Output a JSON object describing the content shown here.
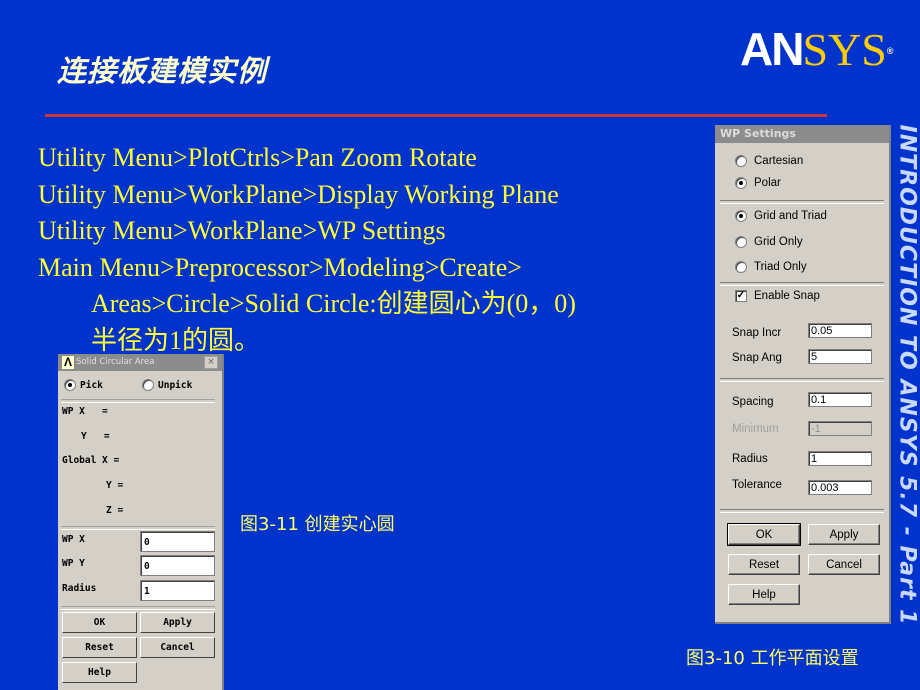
{
  "slide": {
    "title": "连接板建模实例",
    "logo": {
      "part1": "AN",
      "part2": "SYS",
      "reg": "®"
    },
    "side_text": "INTRODUCTION TO ANSYS 5.7 - Part 1",
    "lines": [
      "Utility Menu>PlotCtrls>Pan Zoom Rotate",
      "Utility Menu>WorkPlane>Display Working Plane",
      "Utility Menu>WorkPlane>WP Settings",
      "Main Menu>Preprocessor>Modeling>Create>",
      "Areas>Circle>Solid Circle:创建圆心为(0，0)",
      "半径为1的圆。"
    ],
    "caption_a": "图3-11  创建实心圆",
    "caption_b": "图3-10  工作平面设置"
  },
  "wp_settings": {
    "title": "WP Settings",
    "coord": [
      {
        "label": "Cartesian",
        "selected": false
      },
      {
        "label": "Polar",
        "selected": true
      }
    ],
    "display": [
      {
        "label": "Grid and Triad",
        "selected": true
      },
      {
        "label": "Grid Only",
        "selected": false
      },
      {
        "label": "Triad Only",
        "selected": false
      }
    ],
    "enable_snap": {
      "label": "Enable Snap",
      "checked": true
    },
    "fields": {
      "snap_incr": {
        "label": "Snap Incr",
        "value": "0.05"
      },
      "snap_ang": {
        "label": "Snap Ang",
        "value": "5"
      },
      "spacing": {
        "label": "Spacing",
        "value": "0.1"
      },
      "minimum": {
        "label": "Minimum",
        "value": "-1"
      },
      "radius": {
        "label": "Radius",
        "value": "1"
      },
      "tolerance": {
        "label": "Tolerance",
        "value": "0.003"
      }
    },
    "buttons": {
      "ok": "OK",
      "apply": "Apply",
      "reset": "Reset",
      "cancel": "Cancel",
      "help": "Help"
    }
  },
  "solid_circle": {
    "title": "Solid Circular Area",
    "close": "×",
    "pick": "Pick",
    "unpick": "Unpick",
    "readouts": [
      "WP X   =",
      "Y   =",
      "Global X =",
      "Y =",
      "Z ="
    ],
    "fields": {
      "wpx": {
        "label": "WP X",
        "value": "0"
      },
      "wpy": {
        "label": "WP Y",
        "value": "0"
      },
      "radius": {
        "label": "Radius",
        "value": "1"
      }
    },
    "buttons": {
      "ok": "OK",
      "apply": "Apply",
      "reset": "Reset",
      "cancel": "Cancel",
      "help": "Help"
    }
  }
}
